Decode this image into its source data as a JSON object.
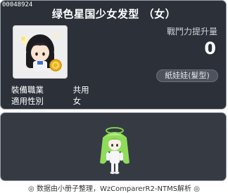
{
  "item": {
    "id": "00048924",
    "title": "绿色星国少女发型 （女）",
    "icon_name": "hair-icon",
    "stat_label": "戰鬥力提升量",
    "stat_value": "0",
    "category": "紙娃娃(髮型)"
  },
  "attributes": [
    {
      "key": "裝備職業",
      "value": "共用"
    },
    {
      "key": "適用性別",
      "value": "女"
    }
  ],
  "preview": {
    "icon_name": "character-preview-icon"
  },
  "footer": "◎ 数据由小册子整理，WzComparerR2-NTMS解析 ◎",
  "colors": {
    "panel": "#2b3039",
    "panel_bottom": "#353a43",
    "border": "#9aa0a8",
    "hair_green": "#7fd24a"
  }
}
